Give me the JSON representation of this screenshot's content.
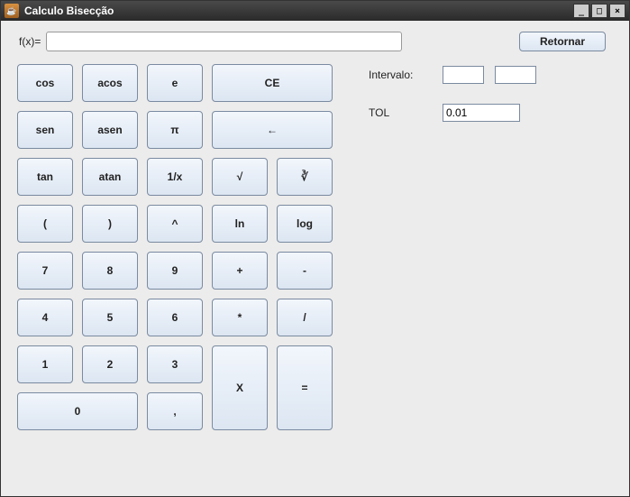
{
  "window": {
    "title": "Calculo Bisecção",
    "icon_glyph": "☕"
  },
  "controls": {
    "minimize": "_",
    "maximize": "□",
    "close": "×"
  },
  "fx": {
    "label": "f(x)=",
    "value": ""
  },
  "retornar": "Retornar",
  "side": {
    "intervalo_label": "Intervalo:",
    "intervalo_a": "",
    "intervalo_b": "",
    "tol_label": "TOL",
    "tol_value": "0.01"
  },
  "keys": {
    "r1": {
      "cos": "cos",
      "acos": "acos",
      "e": "e",
      "ce": "CE"
    },
    "r2": {
      "sen": "sen",
      "asen": "asen",
      "pi": "π",
      "back": "←"
    },
    "r3": {
      "tan": "tan",
      "atan": "atan",
      "inv": "1/x",
      "sqrt": "√",
      "cbrt": "∛"
    },
    "r4": {
      "lp": "(",
      "rp": ")",
      "pow": "^",
      "ln": "ln",
      "log": "log"
    },
    "r5": {
      "n7": "7",
      "n8": "8",
      "n9": "9",
      "plus": "+",
      "minus": "-"
    },
    "r6": {
      "n4": "4",
      "n5": "5",
      "n6": "6",
      "mul": "*",
      "div": "/"
    },
    "r7": {
      "n1": "1",
      "n2": "2",
      "n3": "3"
    },
    "r8": {
      "n0": "0",
      "comma": ","
    },
    "tall": {
      "x": "X",
      "eq": "="
    }
  }
}
